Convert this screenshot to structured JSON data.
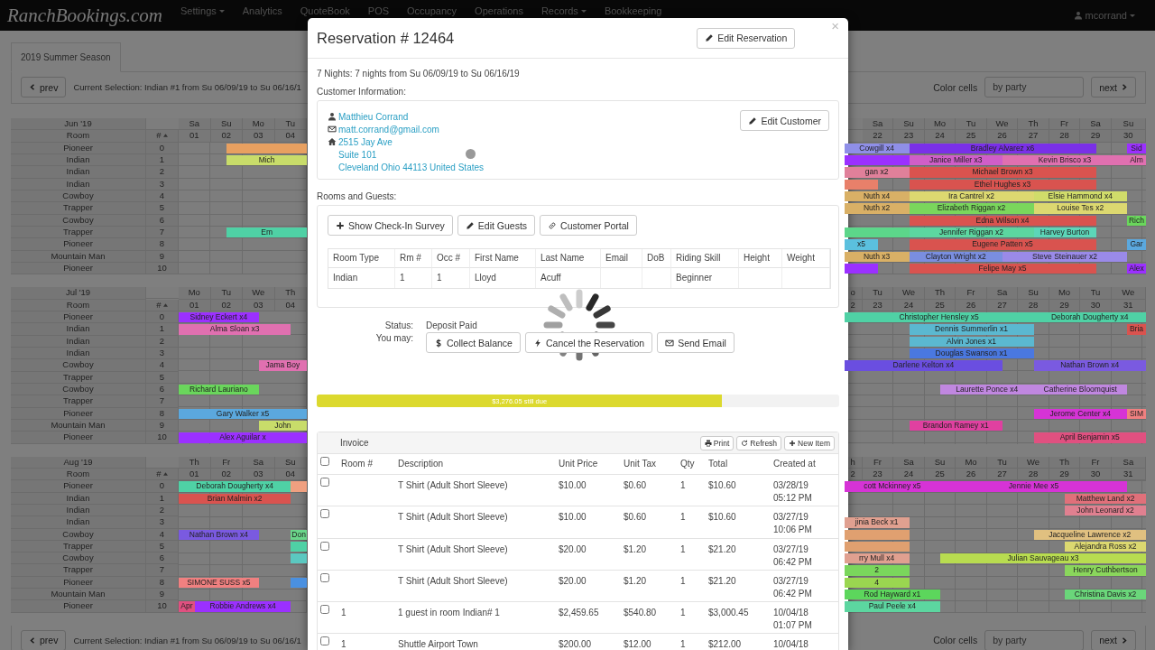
{
  "navbar": {
    "brand": "RanchBookings.com",
    "items": [
      {
        "label": "Settings",
        "dropdown": true
      },
      {
        "label": "Analytics",
        "dropdown": false
      },
      {
        "label": "QuoteBook",
        "dropdown": false
      },
      {
        "label": "POS",
        "dropdown": false
      },
      {
        "label": "Occupancy",
        "dropdown": false
      },
      {
        "label": "Operations",
        "dropdown": false
      },
      {
        "label": "Records",
        "dropdown": true
      },
      {
        "label": "Bookkeeping",
        "dropdown": false
      }
    ],
    "user": {
      "label": "mcorrand",
      "dropdown": true
    }
  },
  "season_tabs": [
    {
      "label": "2019 Summer Season",
      "selected": true
    }
  ],
  "toolbars": [
    {
      "prev": "prev",
      "selection": "Current Selection: Indian #1 from Su 06/09/19 to Su 06/16/1",
      "color_label": "Color cells",
      "color_value": "by party",
      "next": "next"
    },
    {
      "prev": "prev",
      "selection": "Current Selection: Indian #1 from Su 06/09/19 to Su 06/16/1",
      "color_label": "Color cells",
      "color_value": "by party",
      "next": "next"
    }
  ],
  "months": [
    {
      "title": "Jun '19",
      "room_header": "Room",
      "num_header": "#",
      "left_days": [
        {
          "dow": "Sa",
          "date": "01"
        },
        {
          "dow": "Su",
          "date": "02"
        },
        {
          "dow": "Mo",
          "date": "03"
        },
        {
          "dow": "Tu",
          "date": "04"
        }
      ],
      "right_days": [
        {
          "dow": "Sa",
          "date": "22"
        },
        {
          "dow": "Su",
          "date": "23"
        },
        {
          "dow": "Mo",
          "date": "24"
        },
        {
          "dow": "Tu",
          "date": "25"
        },
        {
          "dow": "We",
          "date": "26"
        },
        {
          "dow": "Th",
          "date": "27"
        },
        {
          "dow": "Fr",
          "date": "28"
        },
        {
          "dow": "Sa",
          "date": "29"
        },
        {
          "dow": "Su",
          "date": "30"
        }
      ],
      "rooms": [
        {
          "name": "Pioneer",
          "number": "0",
          "left_bookings": [
            {
              "color": "#e8a060"
            }
          ],
          "right_bookings": [
            {
              "label": "Cowgill x4",
              "color": "#8f8fe8"
            },
            {
              "label": "Bradley Alvarez x6",
              "color": "#7a30e8"
            },
            {
              "label": "Sid",
              "color": "#9b30ff"
            }
          ]
        },
        {
          "name": "Indian",
          "number": "1",
          "left_bookings": [
            {
              "label": "Mich",
              "color": "#c8dc6a"
            }
          ],
          "right_bookings": [
            {
              "color": "#9b30ff"
            },
            {
              "label": "Janice Miller x3",
              "color": "#d05ec8"
            },
            {
              "label": "Kevin Brisco x3",
              "color": "#e070b0"
            },
            {
              "label": "Alm",
              "color": "#e070b1"
            }
          ]
        },
        {
          "name": "Indian",
          "number": "2",
          "right_bookings": [
            {
              "label": "gan x2",
              "color": "#e0809a"
            },
            {
              "label": "Michael Brown x3",
              "color": "#d9534f"
            }
          ]
        },
        {
          "name": "Indian",
          "number": "3",
          "right_bookings": [
            {
              "color": "#e8806a"
            },
            {
              "label": "Ethel Hughes x3",
              "color": "#d9534f"
            }
          ]
        },
        {
          "name": "Cowboy",
          "number": "4",
          "right_bookings": [
            {
              "label": "Nuth x4",
              "color": "#d9b066"
            },
            {
              "label": "Ira Cantrel x2",
              "color": "#dcd870"
            },
            {
              "label": "Elsie Hammond x4",
              "color": "#d0dc6a"
            }
          ]
        },
        {
          "name": "Trapper",
          "number": "5",
          "right_bookings": [
            {
              "label": "Nuth x2",
              "color": "#d9b066"
            },
            {
              "label": "Elizabeth Riggan x2",
              "color": "#7ad65c"
            },
            {
              "label": "Louise Tes x2",
              "color": "#dcd870"
            }
          ]
        },
        {
          "name": "Cowboy",
          "number": "6",
          "right_bookings": [
            {
              "label": "Edna Wilson x4",
              "color": "#d9534f"
            },
            {
              "label": "Rich",
              "color": "#6ad65c"
            }
          ]
        },
        {
          "name": "Trapper",
          "number": "7",
          "left_bookings": [
            {
              "label": "Em",
              "color": "#4fd1a5"
            }
          ],
          "right_bookings": [
            {
              "color": "#5cd68a"
            },
            {
              "label": "Jennifer Riggan x2",
              "color": "#5cd6a0"
            },
            {
              "label": "Harvey Burton",
              "color": "#5cd6b8"
            }
          ]
        },
        {
          "name": "Pioneer",
          "number": "8",
          "right_bookings": [
            {
              "label": "x5",
              "color": "#5bc0de"
            },
            {
              "label": "Eugene Patten x5",
              "color": "#d9534f"
            },
            {
              "label": "Gar",
              "color": "#5ba8de"
            }
          ]
        },
        {
          "name": "Mountain Man",
          "number": "9",
          "right_bookings": [
            {
              "label": "Nuth x3",
              "color": "#d9b066"
            },
            {
              "label": "Clayton Wright x2",
              "color": "#7a8ee0"
            },
            {
              "label": "Steve Steinauer x2",
              "color": "#9a8ae8"
            }
          ]
        },
        {
          "name": "Pioneer",
          "number": "10",
          "right_bookings": [
            {
              "color": "#9b30ff"
            },
            {
              "label": "Felipe May x5",
              "color": "#d9534f"
            },
            {
              "label": "Alex",
              "color": "#9b30ff"
            }
          ]
        }
      ]
    },
    {
      "title": "Jul '19",
      "room_header": "Room",
      "num_header": "#",
      "left_days": [
        {
          "dow": "Mo",
          "date": "01"
        },
        {
          "dow": "Tu",
          "date": "02"
        },
        {
          "dow": "We",
          "date": "03"
        },
        {
          "dow": "Th",
          "date": "04"
        }
      ],
      "right_partial": {
        "dow": "o",
        "date": "2"
      },
      "right_days": [
        {
          "dow": "Tu",
          "date": "23"
        },
        {
          "dow": "We",
          "date": "24"
        },
        {
          "dow": "Th",
          "date": "25"
        },
        {
          "dow": "Fr",
          "date": "26"
        },
        {
          "dow": "Sa",
          "date": "27"
        },
        {
          "dow": "Su",
          "date": "28"
        },
        {
          "dow": "Mo",
          "date": "29"
        },
        {
          "dow": "Tu",
          "date": "30"
        },
        {
          "dow": "We",
          "date": "31"
        }
      ],
      "rooms": [
        {
          "name": "Pioneer",
          "number": "0",
          "left_bookings": [
            {
              "label": "Sidney Eckert x4",
              "color": "#9b30ff"
            }
          ],
          "right_bookings": [
            {
              "label": "Christopher Hensley x5",
              "color": "#4fd1a5"
            },
            {
              "label": "Deborah Dougherty x4",
              "color": "#4fd1a5"
            }
          ]
        },
        {
          "name": "Indian",
          "number": "1",
          "left_bookings": [
            {
              "label": "Alma Sloan x3",
              "color": "#e070b0"
            }
          ],
          "right_bookings": [
            {
              "label": "Dennis Summerlin x1",
              "color": "#5bb8d0"
            },
            {
              "label": "Bria",
              "color": "#d9534f"
            }
          ]
        },
        {
          "name": "Indian",
          "number": "2",
          "right_bookings": [
            {
              "label": "Alvin Jones x1",
              "color": "#5bb8d0"
            }
          ]
        },
        {
          "name": "Indian",
          "number": "3",
          "right_bookings": [
            {
              "label": "Douglas Swanson x1",
              "color": "#4a78e0"
            }
          ]
        },
        {
          "name": "Cowboy",
          "number": "4",
          "left_bookings": [
            {
              "label": "Jama Boy",
              "color": "#e070b0"
            }
          ],
          "right_bookings": [
            {
              "label": "Darlene Kelton x4",
              "color": "#6a4ee0"
            },
            {
              "label": "Nathan Brown x4",
              "color": "#7a5ae0"
            }
          ]
        },
        {
          "name": "Trapper",
          "number": "5"
        },
        {
          "name": "Cowboy",
          "number": "6",
          "left_bookings": [
            {
              "label": "Richard Lauriano",
              "color": "#6ad65c"
            }
          ],
          "right_bookings": [
            {
              "label": "Laurette Ponce x4",
              "color": "#c087e0"
            },
            {
              "label": "Catherine Bloomquist",
              "color": "#c087e0"
            }
          ]
        },
        {
          "name": "Trapper",
          "number": "7"
        },
        {
          "name": "Pioneer",
          "number": "8",
          "left_bookings": [
            {
              "label": "Gary Walker x5",
              "color": "#5ba8de"
            }
          ],
          "right_bookings": [
            {
              "label": "Jerome Center x4",
              "color": "#d633d6"
            },
            {
              "label": "SIM",
              "color": "#f08080"
            }
          ]
        },
        {
          "name": "Mountain Man",
          "number": "9",
          "left_bookings": [
            {
              "label": "John",
              "color": "#c8dc6a"
            }
          ],
          "right_bookings": [
            {
              "label": "Brandon Ramey x1",
              "color": "#e040a0"
            }
          ]
        },
        {
          "name": "Pioneer",
          "number": "10",
          "left_bookings": [
            {
              "label": "Alex Aguilar x",
              "color": "#9b30ff"
            }
          ],
          "right_bookings": [
            {
              "label": "April Benjamin x5",
              "color": "#e05080"
            }
          ]
        }
      ]
    },
    {
      "title": "Aug '19",
      "room_header": "Room",
      "num_header": "#",
      "left_days": [
        {
          "dow": "Th",
          "date": "01"
        },
        {
          "dow": "Fr",
          "date": "02"
        },
        {
          "dow": "Sa",
          "date": "03"
        },
        {
          "dow": "Su",
          "date": "04"
        }
      ],
      "right_partial": {
        "dow": "h",
        "date": "2"
      },
      "right_days": [
        {
          "dow": "Fr",
          "date": "23"
        },
        {
          "dow": "Sa",
          "date": "24"
        },
        {
          "dow": "Su",
          "date": "25"
        },
        {
          "dow": "Mo",
          "date": "26"
        },
        {
          "dow": "Tu",
          "date": "27"
        },
        {
          "dow": "We",
          "date": "28"
        },
        {
          "dow": "Th",
          "date": "29"
        },
        {
          "dow": "Fr",
          "date": "30"
        },
        {
          "dow": "Sa",
          "date": "31"
        }
      ],
      "rooms": [
        {
          "name": "Pioneer",
          "number": "0",
          "left_bookings": [
            {
              "label": "Deborah Dougherty x4",
              "color": "#4fd1a5"
            },
            {
              "color": "#f0a080"
            }
          ],
          "right_bookings": [
            {
              "label": "cott Mckinney x5",
              "color": "#d633d6"
            },
            {
              "label": "Jennie Mee x5",
              "color": "#d633d6"
            }
          ]
        },
        {
          "name": "Indian",
          "number": "1",
          "left_bookings": [
            {
              "label": "Brian Malmin x2",
              "color": "#d9534f"
            }
          ],
          "right_bookings": [
            {
              "label": "Matthew Land x2",
              "color": "#e0707a"
            }
          ]
        },
        {
          "name": "Indian",
          "number": "2",
          "right_bookings": [
            {
              "label": "John Leonard x2",
              "color": "#e08090"
            }
          ]
        },
        {
          "name": "Indian",
          "number": "3",
          "right_bookings": [
            {
              "label": "jinia Beck x1",
              "color": "#e0a090"
            }
          ]
        },
        {
          "name": "Cowboy",
          "number": "4",
          "left_bookings": [
            {
              "label": "Nathan Brown x4",
              "color": "#7a5ae0"
            },
            {
              "label": "Don",
              "color": "#6ad68a"
            }
          ],
          "right_bookings": [
            {
              "color": "#e0a070"
            },
            {
              "label": "Jacqueline Lawrence x2",
              "color": "#e0c080"
            }
          ]
        },
        {
          "name": "Trapper",
          "number": "5",
          "left_bookings": [
            {
              "color": "#4fd1a5"
            }
          ],
          "right_bookings": [
            {
              "color": "#e0a070"
            },
            {
              "label": "Alejandra Ross x2",
              "color": "#dcd870"
            }
          ]
        },
        {
          "name": "Cowboy",
          "number": "6",
          "left_bookings": [
            {
              "color": "#5bc8c0"
            }
          ],
          "right_bookings": [
            {
              "label": "rry Mull x4",
              "color": "#e0a090"
            },
            {
              "label": "Julian Sauvageau x3",
              "color": "#b8dc50"
            }
          ]
        },
        {
          "name": "Trapper",
          "number": "7",
          "right_bookings": [
            {
              "label": "2",
              "color": "#7ad65c"
            },
            {
              "label": "Henry Cuthbertson",
              "color": "#8ad65c"
            }
          ]
        },
        {
          "name": "Pioneer",
          "number": "8",
          "left_bookings": [
            {
              "label": "SIMONE SUSS x5",
              "color": "#f08080"
            },
            {
              "color": "#4a90e0"
            }
          ],
          "right_bookings": [
            {
              "label": "4",
              "color": "#9ad650"
            }
          ]
        },
        {
          "name": "Mountain Man",
          "number": "9",
          "right_bookings": [
            {
              "label": "Rod Hayward x1",
              "color": "#5cd65c"
            },
            {
              "label": "Christina Davis x2",
              "color": "#6ad67a"
            }
          ]
        },
        {
          "name": "Pioneer",
          "number": "10",
          "left_bookings": [
            {
              "label": "Apr",
              "color": "#e05080"
            },
            {
              "label": "Robbie Andrews x4",
              "color": "#9b30ff"
            }
          ],
          "right_bookings": [
            {
              "label": "Paul Peele x4",
              "color": "#5cd6a0"
            }
          ]
        }
      ]
    }
  ],
  "modal": {
    "title": "Reservation # 12464",
    "edit_button": "Edit Reservation",
    "close": "×",
    "nights": "7 Nights: 7 nights from Su 06/09/19 to Su 06/16/19",
    "customer_heading": "Customer Information:",
    "customer_lines": [
      "Matthieu Corrand",
      "matt.corrand@gmail.com",
      "2515 Jay Ave",
      "Suite 101",
      "Cleveland Ohio 44113 United States"
    ],
    "customer_button": "Edit Customer",
    "rooms_heading": "Rooms and Guests:",
    "guest_buttons": [
      "Show Check-In Survey",
      "Edit Guests",
      "Customer Portal"
    ],
    "guest_columns": [
      "Room Type",
      "Rm #",
      "Occ #",
      "First Name",
      "Last Name",
      "Email",
      "DoB",
      "Riding Skill",
      "Height",
      "Weight"
    ],
    "guest_rows": [
      [
        "Indian",
        "1",
        "1",
        "Lloyd",
        "Acuff",
        null,
        null,
        "Beginner",
        null,
        null
      ]
    ],
    "status_label": "Status:",
    "status_value": "Deposit Paid",
    "actions_label": "You may:",
    "actions": [
      "Collect Balance",
      "Cancel the Reservation",
      "Send Email"
    ],
    "loading": true,
    "payment": {
      "level": 0.776,
      "label": "$3,276.05 still due"
    },
    "invoice": {
      "title": "Invoice",
      "buttons": [
        "Print",
        "Refresh",
        "New Item"
      ],
      "select_all": {
        "checked": false
      },
      "columns": [
        "Room #",
        "Description",
        "Unit Price",
        "Unit Tax",
        "Qty",
        "Total",
        "Created at"
      ],
      "rows": [
        {
          "checked": false,
          "cells": [
            null,
            "T Shirt (Adult Short Sleeve)",
            "$10.00",
            "$0.60",
            "1",
            "$10.60",
            "03/28/19\n05:12 PM"
          ]
        },
        {
          "checked": false,
          "cells": [
            null,
            "T Shirt (Adult Short Sleeve)",
            "$10.00",
            "$0.60",
            "1",
            "$10.60",
            "03/27/19\n10:06 PM"
          ]
        },
        {
          "checked": false,
          "cells": [
            null,
            "T Shirt (Adult Short Sleeve)",
            "$20.00",
            "$1.20",
            "1",
            "$21.20",
            "03/27/19\n06:42 PM"
          ]
        },
        {
          "checked": false,
          "cells": [
            null,
            "T Shirt (Adult Short Sleeve)",
            "$20.00",
            "$1.20",
            "1",
            "$21.20",
            "03/27/19\n06:42 PM"
          ]
        },
        {
          "checked": false,
          "cells": [
            "1",
            "1 guest in room Indian# 1",
            "$2,459.65",
            "$540.80",
            "1",
            "$3,000.45",
            "10/04/18\n01:07 PM"
          ]
        },
        {
          "checked": false,
          "cells": [
            "1",
            "Shuttle Airport Town",
            "$200.00",
            "$12.00",
            "1",
            "$212.00",
            "10/04/18"
          ]
        }
      ]
    }
  }
}
